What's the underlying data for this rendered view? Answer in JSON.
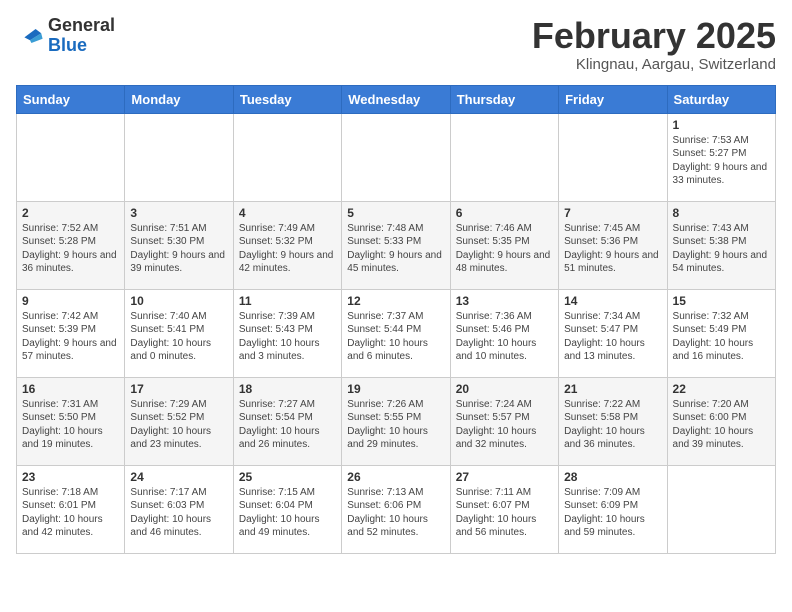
{
  "header": {
    "logo_line1": "General",
    "logo_line2": "Blue",
    "month_title": "February 2025",
    "location": "Klingnau, Aargau, Switzerland"
  },
  "days_of_week": [
    "Sunday",
    "Monday",
    "Tuesday",
    "Wednesday",
    "Thursday",
    "Friday",
    "Saturday"
  ],
  "weeks": [
    [
      {
        "day": "",
        "info": ""
      },
      {
        "day": "",
        "info": ""
      },
      {
        "day": "",
        "info": ""
      },
      {
        "day": "",
        "info": ""
      },
      {
        "day": "",
        "info": ""
      },
      {
        "day": "",
        "info": ""
      },
      {
        "day": "1",
        "info": "Sunrise: 7:53 AM\nSunset: 5:27 PM\nDaylight: 9 hours and 33 minutes."
      }
    ],
    [
      {
        "day": "2",
        "info": "Sunrise: 7:52 AM\nSunset: 5:28 PM\nDaylight: 9 hours and 36 minutes."
      },
      {
        "day": "3",
        "info": "Sunrise: 7:51 AM\nSunset: 5:30 PM\nDaylight: 9 hours and 39 minutes."
      },
      {
        "day": "4",
        "info": "Sunrise: 7:49 AM\nSunset: 5:32 PM\nDaylight: 9 hours and 42 minutes."
      },
      {
        "day": "5",
        "info": "Sunrise: 7:48 AM\nSunset: 5:33 PM\nDaylight: 9 hours and 45 minutes."
      },
      {
        "day": "6",
        "info": "Sunrise: 7:46 AM\nSunset: 5:35 PM\nDaylight: 9 hours and 48 minutes."
      },
      {
        "day": "7",
        "info": "Sunrise: 7:45 AM\nSunset: 5:36 PM\nDaylight: 9 hours and 51 minutes."
      },
      {
        "day": "8",
        "info": "Sunrise: 7:43 AM\nSunset: 5:38 PM\nDaylight: 9 hours and 54 minutes."
      }
    ],
    [
      {
        "day": "9",
        "info": "Sunrise: 7:42 AM\nSunset: 5:39 PM\nDaylight: 9 hours and 57 minutes."
      },
      {
        "day": "10",
        "info": "Sunrise: 7:40 AM\nSunset: 5:41 PM\nDaylight: 10 hours and 0 minutes."
      },
      {
        "day": "11",
        "info": "Sunrise: 7:39 AM\nSunset: 5:43 PM\nDaylight: 10 hours and 3 minutes."
      },
      {
        "day": "12",
        "info": "Sunrise: 7:37 AM\nSunset: 5:44 PM\nDaylight: 10 hours and 6 minutes."
      },
      {
        "day": "13",
        "info": "Sunrise: 7:36 AM\nSunset: 5:46 PM\nDaylight: 10 hours and 10 minutes."
      },
      {
        "day": "14",
        "info": "Sunrise: 7:34 AM\nSunset: 5:47 PM\nDaylight: 10 hours and 13 minutes."
      },
      {
        "day": "15",
        "info": "Sunrise: 7:32 AM\nSunset: 5:49 PM\nDaylight: 10 hours and 16 minutes."
      }
    ],
    [
      {
        "day": "16",
        "info": "Sunrise: 7:31 AM\nSunset: 5:50 PM\nDaylight: 10 hours and 19 minutes."
      },
      {
        "day": "17",
        "info": "Sunrise: 7:29 AM\nSunset: 5:52 PM\nDaylight: 10 hours and 23 minutes."
      },
      {
        "day": "18",
        "info": "Sunrise: 7:27 AM\nSunset: 5:54 PM\nDaylight: 10 hours and 26 minutes."
      },
      {
        "day": "19",
        "info": "Sunrise: 7:26 AM\nSunset: 5:55 PM\nDaylight: 10 hours and 29 minutes."
      },
      {
        "day": "20",
        "info": "Sunrise: 7:24 AM\nSunset: 5:57 PM\nDaylight: 10 hours and 32 minutes."
      },
      {
        "day": "21",
        "info": "Sunrise: 7:22 AM\nSunset: 5:58 PM\nDaylight: 10 hours and 36 minutes."
      },
      {
        "day": "22",
        "info": "Sunrise: 7:20 AM\nSunset: 6:00 PM\nDaylight: 10 hours and 39 minutes."
      }
    ],
    [
      {
        "day": "23",
        "info": "Sunrise: 7:18 AM\nSunset: 6:01 PM\nDaylight: 10 hours and 42 minutes."
      },
      {
        "day": "24",
        "info": "Sunrise: 7:17 AM\nSunset: 6:03 PM\nDaylight: 10 hours and 46 minutes."
      },
      {
        "day": "25",
        "info": "Sunrise: 7:15 AM\nSunset: 6:04 PM\nDaylight: 10 hours and 49 minutes."
      },
      {
        "day": "26",
        "info": "Sunrise: 7:13 AM\nSunset: 6:06 PM\nDaylight: 10 hours and 52 minutes."
      },
      {
        "day": "27",
        "info": "Sunrise: 7:11 AM\nSunset: 6:07 PM\nDaylight: 10 hours and 56 minutes."
      },
      {
        "day": "28",
        "info": "Sunrise: 7:09 AM\nSunset: 6:09 PM\nDaylight: 10 hours and 59 minutes."
      },
      {
        "day": "",
        "info": ""
      }
    ]
  ]
}
